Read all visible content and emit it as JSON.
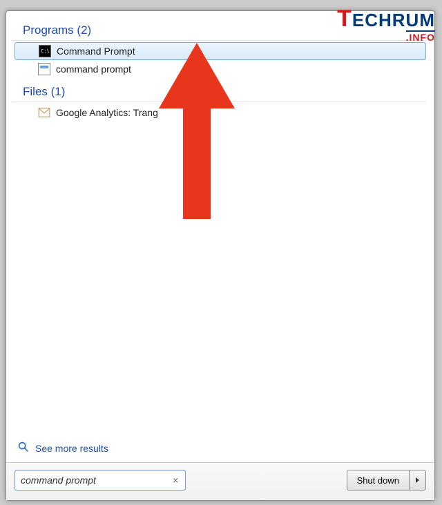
{
  "sections": {
    "programs": {
      "header": "Programs (2)",
      "items": [
        {
          "label": "Command Prompt"
        },
        {
          "label": "command prompt"
        }
      ]
    },
    "files": {
      "header": "Files (1)",
      "items": [
        {
          "label": "Google Analytics: Trang"
        }
      ]
    }
  },
  "see_more": "See more results",
  "search": {
    "value": "command prompt"
  },
  "shutdown": {
    "label": "Shut down"
  },
  "watermark": {
    "brand_t": "T",
    "brand_rest": "ECHRUM",
    "suffix": ".INFO"
  }
}
